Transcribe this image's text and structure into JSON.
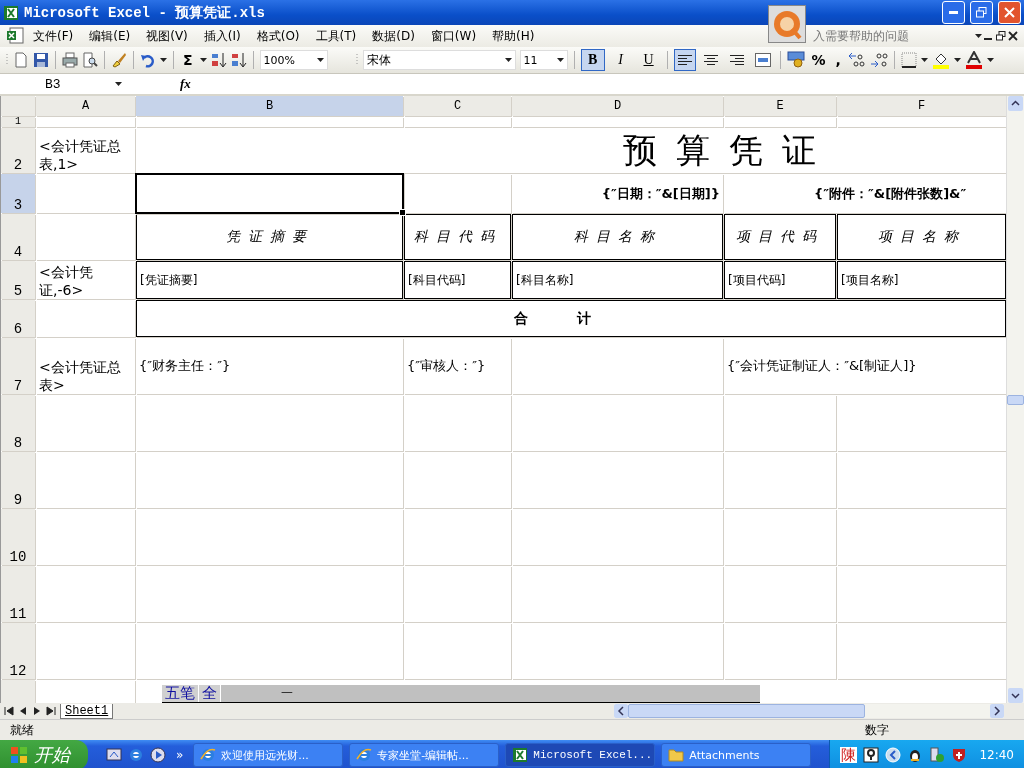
{
  "window": {
    "title": "Microsoft Excel - 预算凭证.xls"
  },
  "menu": [
    "文件(F)",
    "编辑(E)",
    "视图(V)",
    "插入(I)",
    "格式(O)",
    "工具(T)",
    "数据(D)",
    "窗口(W)",
    "帮助(H)"
  ],
  "help_box": {
    "placeholder": "入需要帮助的问题"
  },
  "toolbar": {
    "sum": "Σ",
    "zoom": "100%",
    "font": "宋体",
    "size": "11",
    "percent": "%",
    "comma": ",",
    "format_buttons": [
      {
        "label": "B",
        "pressed": true
      },
      {
        "label": "I",
        "pressed": false
      },
      {
        "label": "U",
        "pressed": false
      }
    ],
    "align_buttons": [
      {
        "kind": "left",
        "pressed": true
      },
      {
        "kind": "center",
        "pressed": false
      },
      {
        "kind": "right",
        "pressed": false
      },
      {
        "kind": "merge",
        "pressed": false
      }
    ]
  },
  "formula_bar": {
    "name_box": "B3",
    "function_label": "fx"
  },
  "sheet": {
    "columns": [
      {
        "label": "A",
        "selected": false
      },
      {
        "label": "B",
        "selected": true
      },
      {
        "label": "C",
        "selected": false
      },
      {
        "label": "D",
        "selected": false
      },
      {
        "label": "E",
        "selected": false
      },
      {
        "label": "F",
        "selected": false
      }
    ],
    "rows": [
      {
        "label": "1",
        "selected": false
      },
      {
        "label": "2",
        "selected": false
      },
      {
        "label": "3",
        "selected": true
      },
      {
        "label": "4",
        "selected": false
      },
      {
        "label": "5",
        "selected": false
      },
      {
        "label": "6",
        "selected": false
      },
      {
        "label": "7",
        "selected": false
      },
      {
        "label": "8",
        "selected": false
      },
      {
        "label": "9",
        "selected": false
      },
      {
        "label": "10",
        "selected": false
      },
      {
        "label": "11",
        "selected": false
      },
      {
        "label": "12",
        "selected": false
      }
    ],
    "cells": [
      {
        "kind": "note",
        "text": "<会计凭证总表,1>"
      },
      {
        "kind": "title",
        "text": "预 算 凭 证"
      },
      {
        "kind": "date",
        "text": "{″日期：″&[日期]}"
      },
      {
        "kind": "date",
        "text": "{″附件：″&[附件张数]&″"
      },
      {
        "kind": "header",
        "text": "凭证摘要"
      },
      {
        "kind": "header",
        "text": "科目代码"
      },
      {
        "kind": "header",
        "text": "科目名称"
      },
      {
        "kind": "header",
        "text": "项目代码"
      },
      {
        "kind": "header",
        "text": "项目名称"
      },
      {
        "kind": "note",
        "text": "<会计凭证,-6>"
      },
      {
        "kind": "field",
        "text": "[凭证摘要]"
      },
      {
        "kind": "field",
        "text": "[科目代码]"
      },
      {
        "kind": "field",
        "text": "[科目名称]"
      },
      {
        "kind": "field",
        "text": "[项目代码]"
      },
      {
        "kind": "field",
        "text": "[项目名称]"
      },
      {
        "kind": "total",
        "text": "合          计"
      },
      {
        "kind": "note",
        "text": "<会计凭证总表>"
      },
      {
        "kind": "sign",
        "text": "{″财务主任：″}"
      },
      {
        "kind": "sign",
        "text": "{″审核人：″}"
      },
      {
        "kind": "sign",
        "text": "{″会计凭证制证人：″&[制证人]}"
      }
    ]
  },
  "sheet_tabs": [
    {
      "label": "Sheet1",
      "selected": true
    }
  ],
  "ime_bar": {
    "items": [
      "五笔",
      "全"
    ],
    "mark": "一"
  },
  "status_bar": {
    "left": "就绪",
    "right": "数字"
  },
  "taskbar": {
    "start": "开始",
    "more": "»",
    "tasks": [
      {
        "label": "欢迎使用远光财...",
        "kind": "web",
        "selected": false
      },
      {
        "label": "专家坐堂-编辑帖...",
        "kind": "web",
        "selected": false
      },
      {
        "label": "Microsoft Excel...",
        "kind": "excel",
        "selected": true
      },
      {
        "label": "Attachments",
        "kind": "folder",
        "selected": false
      }
    ],
    "tray_char": "陳",
    "clock": "12:40"
  }
}
